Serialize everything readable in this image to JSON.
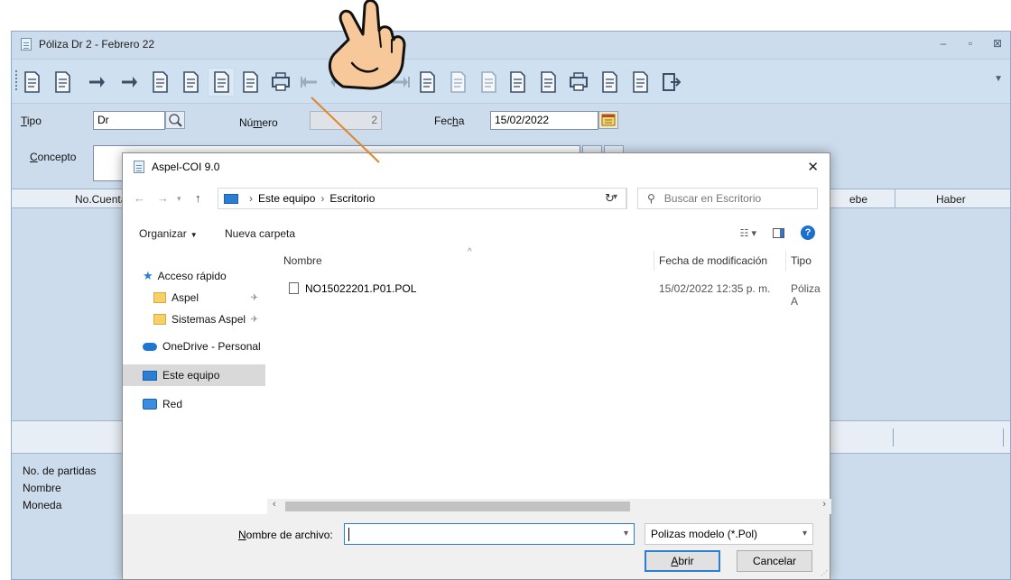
{
  "main_window": {
    "title": "Póliza Dr    2 - Febrero 22",
    "controls": [
      "–",
      "▫",
      "⊠"
    ]
  },
  "form": {
    "tipo_label_first": "T",
    "tipo_label_rest": "ipo",
    "tipo_value": "Dr",
    "numero_label_a": "Nú",
    "numero_label_b": "m",
    "numero_label_c": "ero",
    "numero_value": "2",
    "fecha_label_a": "Fec",
    "fecha_label_b": "h",
    "fecha_label_c": "a",
    "fecha_value": "15/02/2022",
    "concepto_label_first": "C",
    "concepto_label_rest": "oncepto"
  },
  "grid": {
    "columns": [
      "No.Cuenta",
      "ebe",
      "Haber"
    ]
  },
  "info": {
    "partidas": "No. de partidas",
    "nombre": "Nombre",
    "moneda": "Moneda"
  },
  "dialog": {
    "title": "Aspel-COI 9.0",
    "breadcrumb": [
      "Este equipo",
      "Escritorio"
    ],
    "search_placeholder": "Buscar en Escritorio",
    "organize": "Organizar",
    "new_folder": "Nueva carpeta",
    "nav": {
      "quick_access": "Acceso rápido",
      "aspel": "Aspel",
      "sistemas_aspel": "Sistemas Aspel",
      "onedrive": "OneDrive - Personal",
      "this_pc": "Este equipo",
      "network": "Red"
    },
    "columns": {
      "name": "Nombre",
      "modified": "Fecha de modificación",
      "type": "Tipo"
    },
    "files": [
      {
        "name": "NO15022201.P01.POL",
        "modified": "15/02/2022 12:35 p. m.",
        "type": "Póliza A"
      }
    ],
    "filename_label_first": "N",
    "filename_label_rest": "ombre de archivo:",
    "filename_value": "",
    "filter": "Polizas modelo (*.Pol)",
    "open_first": "A",
    "open_rest": "brir",
    "cancel": "Cancelar"
  },
  "colors": {
    "window_bg": "#ccdcec",
    "accent": "#2a7fd4",
    "annotation_line": "#e0852a"
  }
}
